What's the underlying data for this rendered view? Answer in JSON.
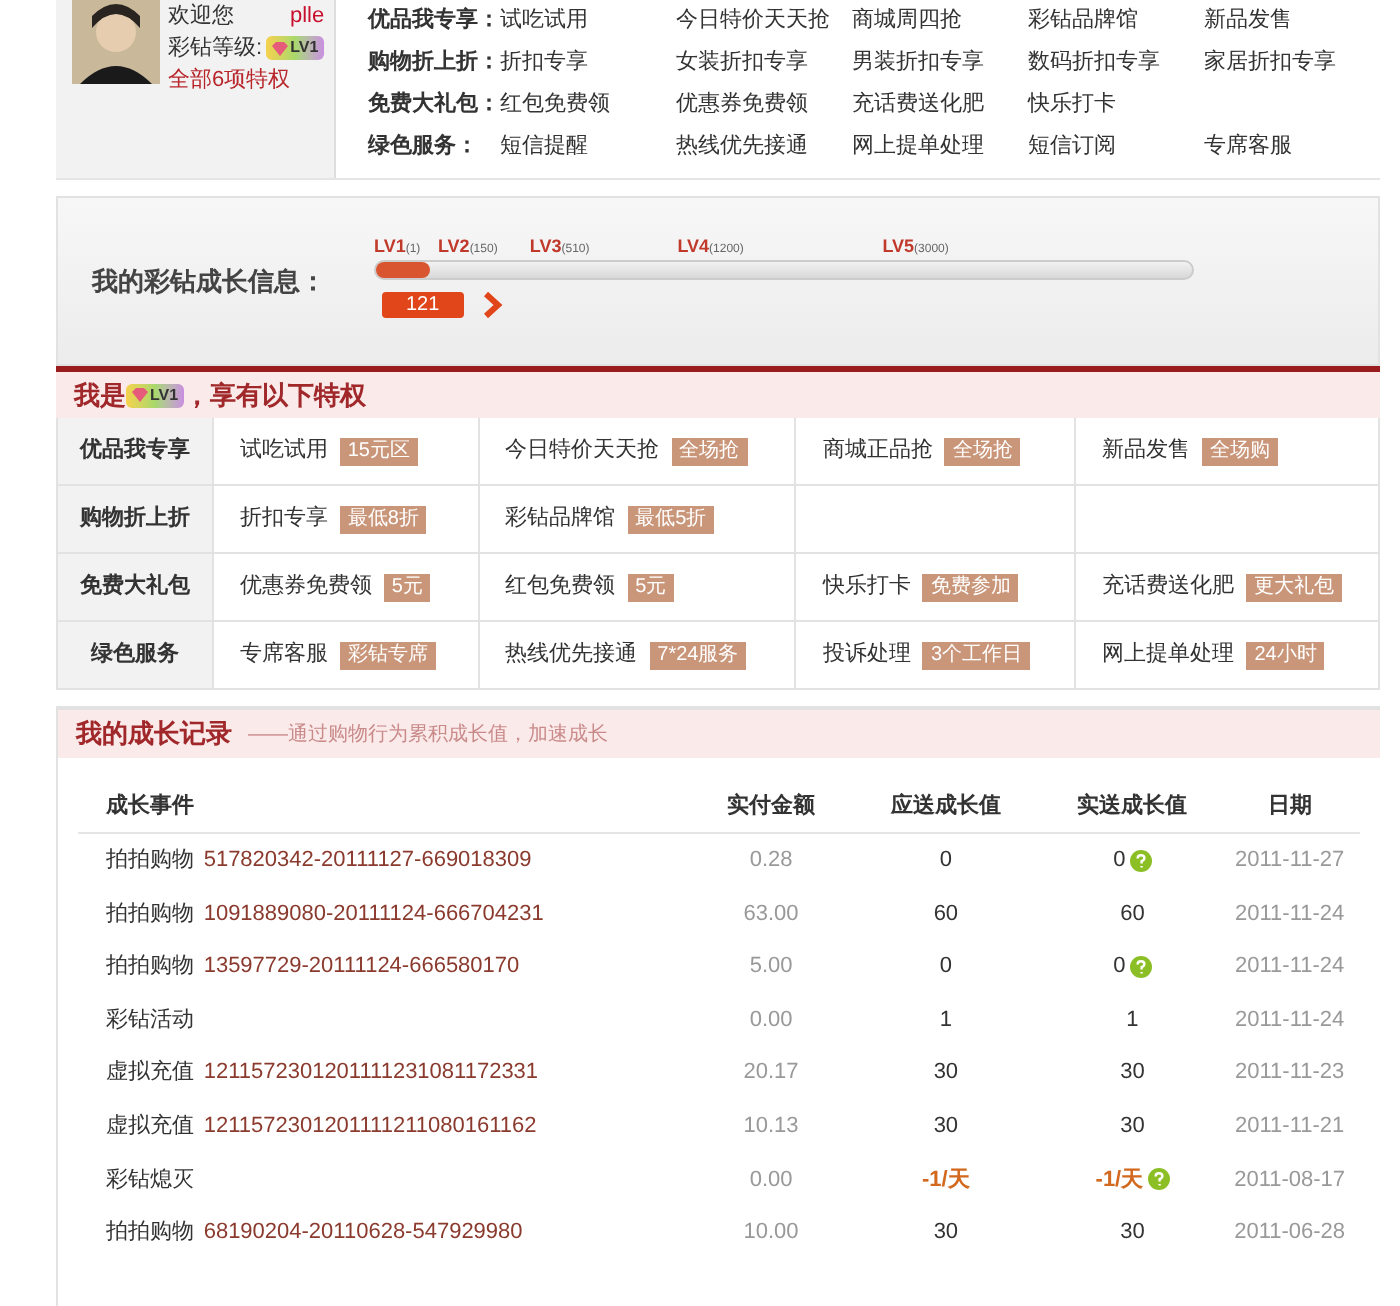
{
  "user": {
    "greeting": "欢迎您",
    "name": "plle",
    "level_label": "彩钻等级:",
    "level_badge": "LV1",
    "privileges_link": "全部6项特权"
  },
  "quick_links": [
    {
      "label": "优品我专享：",
      "items": [
        "试吃试用",
        "今日特价天天抢",
        "商城周四抢",
        "彩钻品牌馆",
        "新品发售"
      ]
    },
    {
      "label": "购物折上折：",
      "items": [
        "折扣专享",
        "女装折扣专享",
        "男装折扣专享",
        "数码折扣专享",
        "家居折扣专享"
      ]
    },
    {
      "label": "免费大礼包：",
      "items": [
        "红包免费领",
        "优惠券免费领",
        "充话费送化肥",
        "快乐打卡"
      ]
    },
    {
      "label": "绿色服务：",
      "items": [
        "短信提醒",
        "热线优先接通",
        "网上提单处理",
        "短信订阅",
        "专席客服"
      ]
    }
  ],
  "growth": {
    "title": "我的彩钻成长信息：",
    "level": 0.065,
    "value": "121",
    "levels": [
      {
        "name": "LV1",
        "points": "(1)"
      },
      {
        "name": "LV2",
        "points": "(150)"
      },
      {
        "name": "LV3",
        "points": "(510)"
      },
      {
        "name": "LV4",
        "points": "(1200)"
      },
      {
        "name": "LV5",
        "points": "(3000)"
      }
    ]
  },
  "privileges": {
    "title_before": "我是",
    "badge": "LV1",
    "title_after": "，享有以下特权",
    "rows": [
      {
        "label": "优品我专享",
        "cells": [
          {
            "name": "试吃试用",
            "tag": "15元区"
          },
          {
            "name": "今日特价天天抢",
            "tag": "全场抢"
          },
          {
            "name": "商城正品抢",
            "tag": "全场抢"
          },
          {
            "name": "新品发售",
            "tag": "全场购"
          }
        ]
      },
      {
        "label": "购物折上折",
        "cells": [
          {
            "name": "折扣专享",
            "tag": "最低8折"
          },
          {
            "name": "彩钻品牌馆",
            "tag": "最低5折"
          }
        ]
      },
      {
        "label": "免费大礼包",
        "cells": [
          {
            "name": "优惠券免费领",
            "tag": "5元"
          },
          {
            "name": "红包免费领",
            "tag": "5元"
          },
          {
            "name": "快乐打卡",
            "tag": "免费参加"
          },
          {
            "name": "充话费送化肥",
            "tag": "更大礼包"
          }
        ]
      },
      {
        "label": "绿色服务",
        "cells": [
          {
            "name": "专席客服",
            "tag": "彩钻专席"
          },
          {
            "name": "热线优先接通",
            "tag": "7*24服务"
          },
          {
            "name": "投诉处理",
            "tag": "3个工作日"
          },
          {
            "name": "网上提单处理",
            "tag": "24小时"
          }
        ]
      }
    ]
  },
  "records": {
    "title": "我的成长记录",
    "subtitle": "——通过购物行为累积成长值，加速成长",
    "columns": [
      "成长事件",
      "实付金额",
      "应送成长值",
      "实送成长值",
      "日期"
    ],
    "rows": [
      {
        "event": "拍拍购物",
        "order": "517820342-20111127-669018309",
        "amount": "0.28",
        "due": "0",
        "given": "0",
        "flagged": true,
        "kind": "normal",
        "date": "2011-11-27"
      },
      {
        "event": "拍拍购物",
        "order": "1091889080-20111124-666704231",
        "amount": "63.00",
        "due": "60",
        "given": "60",
        "flagged": false,
        "kind": "normal",
        "date": "2011-11-24"
      },
      {
        "event": "拍拍购物",
        "order": "13597729-20111124-666580170",
        "amount": "5.00",
        "due": "0",
        "given": "0",
        "flagged": true,
        "kind": "normal",
        "date": "2011-11-24"
      },
      {
        "event": "彩钻活动",
        "amount": "0.00",
        "due": "1",
        "given": "1",
        "flagged": false,
        "kind": "normal",
        "date": "2011-11-24"
      },
      {
        "event": "虚拟充值",
        "order": "1211572301201111231081172331",
        "amount": "20.17",
        "due": "30",
        "given": "30",
        "flagged": false,
        "kind": "normal",
        "date": "2011-11-23"
      },
      {
        "event": "虚拟充值",
        "order": "1211572301201111211080161162",
        "amount": "10.13",
        "due": "30",
        "given": "30",
        "flagged": false,
        "kind": "normal",
        "date": "2011-11-21"
      },
      {
        "event": "彩钻熄灭",
        "amount": "0.00",
        "due": "-1/天",
        "given": "-1/天",
        "flagged": true,
        "kind": "penalty",
        "date": "2011-08-17"
      },
      {
        "event": "拍拍购物",
        "order": "68190204-20110628-547929980",
        "amount": "10.00",
        "due": "30",
        "given": "30",
        "flagged": false,
        "kind": "normal",
        "date": "2011-06-28"
      }
    ]
  }
}
